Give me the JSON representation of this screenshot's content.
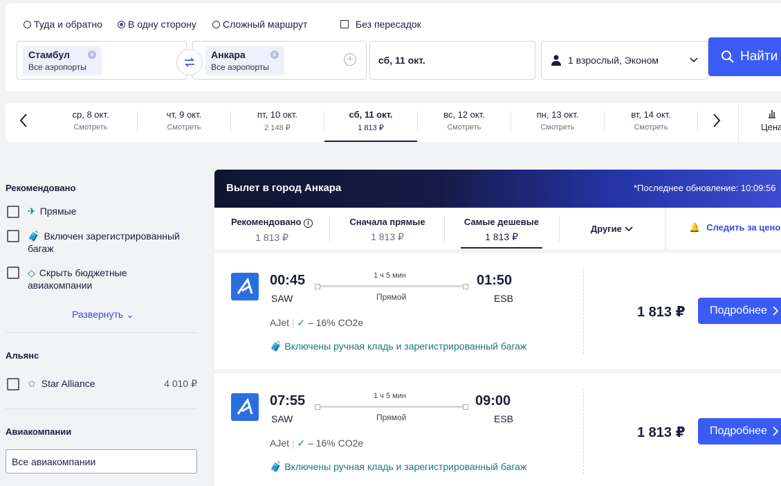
{
  "search": {
    "trip_types": [
      {
        "label": "Туда и обратно",
        "selected": false
      },
      {
        "label": "В одну сторону",
        "selected": true
      },
      {
        "label": "Сложный маршрут",
        "selected": false
      }
    ],
    "nonstop_label": "Без пересадок",
    "from": {
      "city": "Стамбул",
      "airports": "Все аэропорты"
    },
    "to": {
      "city": "Анкара",
      "airports": "Все аэропорты"
    },
    "date": "сб, 11 окт.",
    "passengers": "1 взрослый, Эконом",
    "find_label": "Найти"
  },
  "date_strip": {
    "days": [
      {
        "label": "ср, 8 окт.",
        "price": "Смотреть"
      },
      {
        "label": "чт, 9 окт.",
        "price": "Смотреть"
      },
      {
        "label": "пт, 10 окт.",
        "price": "2 148 ₽"
      },
      {
        "label": "сб, 11 окт.",
        "price": "1 813 ₽",
        "selected": true
      },
      {
        "label": "вс, 12 окт.",
        "price": "Смотреть"
      },
      {
        "label": "пн, 13 окт.",
        "price": "Смотреть"
      },
      {
        "label": "вт, 14 окт.",
        "price": "Смотреть"
      }
    ],
    "prices_label": "Цена"
  },
  "sidebar": {
    "recommended_title": "Рекомендовано",
    "recommended": [
      {
        "label": "Прямые",
        "icon": "plane-icon"
      },
      {
        "label": "Включен зарегистрированный багаж",
        "icon": "luggage-icon"
      },
      {
        "label": "Скрыть бюджетные авиакомпании",
        "icon": "tag-icon"
      }
    ],
    "expand_label": "Развернуть",
    "alliance_title": "Альянс",
    "alliance": {
      "label": "Star Alliance",
      "price": "4 010 ₽"
    },
    "airlines_title": "Авиакомпании",
    "airlines_value": "Все авиакомпании"
  },
  "results": {
    "banner_title": "Вылет в город Анкара",
    "banner_update": "*Последнее обновление: 10:09:56",
    "sorts": [
      {
        "label": "Рекомендовано",
        "price": "1 813 ₽"
      },
      {
        "label": "Сначала прямые",
        "price": "1 813 ₽"
      },
      {
        "label": "Самые дешевые",
        "price": "1 813 ₽",
        "selected": true
      }
    ],
    "other_label": "Другие",
    "track_label": "Следить за ценой",
    "flights": [
      {
        "dep_time": "00:45",
        "dep_apt": "SAW",
        "duration": "1 ч 5 мин",
        "type": "Прямой",
        "arr_time": "01:50",
        "arr_apt": "ESB",
        "airline": "AJet",
        "co2": "– 16% CO2e",
        "baggage": "Включены ручная кладь и зарегистрированный багаж",
        "price": "1 813 ₽",
        "more": "Подробнее"
      },
      {
        "dep_time": "07:55",
        "dep_apt": "SAW",
        "duration": "1 ч 5 мин",
        "type": "Прямой",
        "arr_time": "09:00",
        "arr_apt": "ESB",
        "airline": "AJet",
        "co2": "– 16% CO2e",
        "baggage": "Включены ручная кладь и зарегистрированный багаж",
        "price": "1 813 ₽",
        "more": "Подробнее"
      }
    ]
  },
  "colors": {
    "accent": "#3a5cf5",
    "text": "#1b1f3b",
    "green": "#1a7a6e"
  }
}
